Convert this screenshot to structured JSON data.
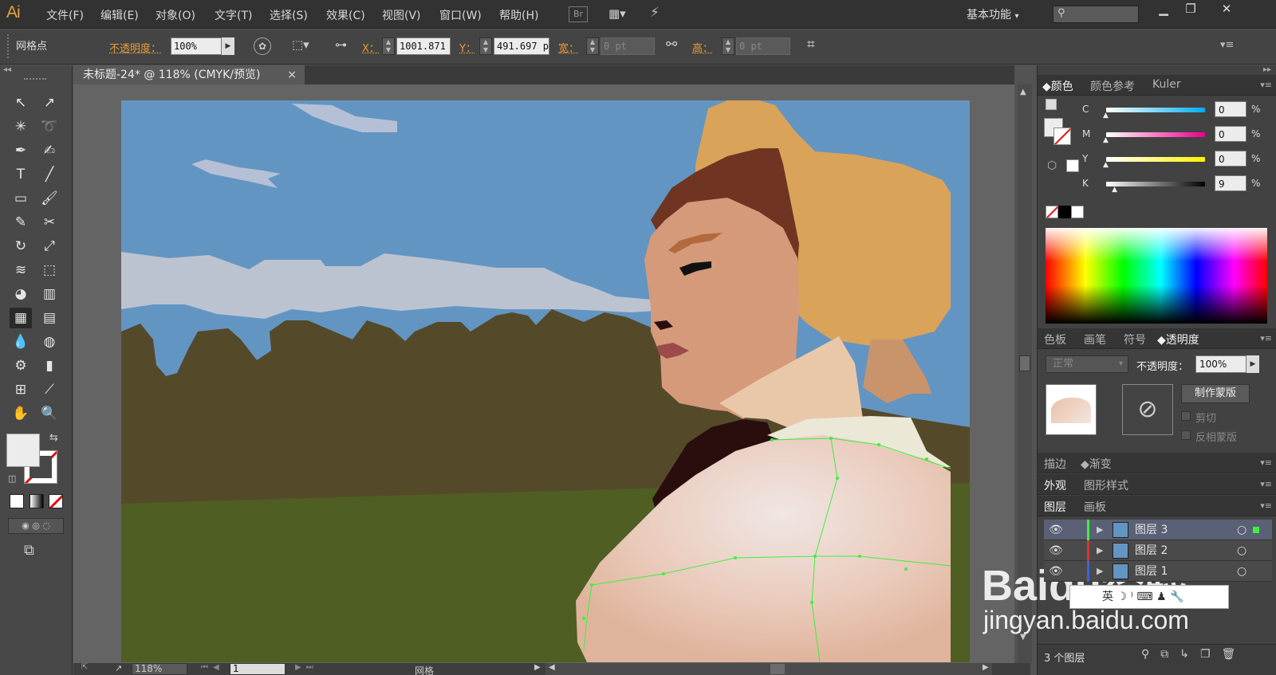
{
  "app": {
    "logo": "Ai",
    "workspace": "基本功能",
    "br": "Br"
  },
  "menu": [
    "文件(F)",
    "编辑(E)",
    "对象(O)",
    "文字(T)",
    "选择(S)",
    "效果(C)",
    "视图(V)",
    "窗口(W)",
    "帮助(H)"
  ],
  "control": {
    "selection": "网格点",
    "opacity_label": "不透明度：",
    "opacity": "100%",
    "x_label": "X：",
    "x": "1001.871",
    "y_label": "Y：",
    "y": "491.697 p",
    "w_label": "宽：",
    "w": "0 pt",
    "h_label": "高：",
    "h": "0 pt"
  },
  "document": {
    "tab": "未标题-24* @ 118% (CMYK/预览)",
    "zoom": "118%",
    "page": "1",
    "status": "网格"
  },
  "color_panel": {
    "tabs": [
      "颜色",
      "颜色参考",
      "Kuler"
    ],
    "channels": [
      {
        "label": "C",
        "value": "0",
        "pct": 0
      },
      {
        "label": "M",
        "value": "0",
        "pct": 0
      },
      {
        "label": "Y",
        "value": "0",
        "pct": 0
      },
      {
        "label": "K",
        "value": "9",
        "pct": 9
      }
    ],
    "unit": "%"
  },
  "transparency_panel": {
    "tabs": [
      "色板",
      "画笔",
      "符号",
      "透明度"
    ],
    "mode": "正常",
    "opacity_label": "不透明度：",
    "opacity": "100%",
    "make_mask": "制作蒙版",
    "clip": "剪切",
    "invert": "反相蒙版"
  },
  "stroke_tabs": [
    "描边",
    "渐变"
  ],
  "appearance_tabs": [
    "外观",
    "图形样式"
  ],
  "layers_panel": {
    "tabs": [
      "图层",
      "画板"
    ],
    "layers": [
      "图层 3",
      "图层 2",
      "图层 1"
    ],
    "count": "3 个图层"
  },
  "watermark": {
    "brand": "Baidu经验",
    "url": "jingyan.baidu.com"
  },
  "colors": {
    "accent": "#e79b3a",
    "sky": "#6395c2",
    "cloud": "#bcc3d0",
    "trees": "#544a2a",
    "grass": "#4f5e22",
    "mesh": "#3df03d"
  }
}
